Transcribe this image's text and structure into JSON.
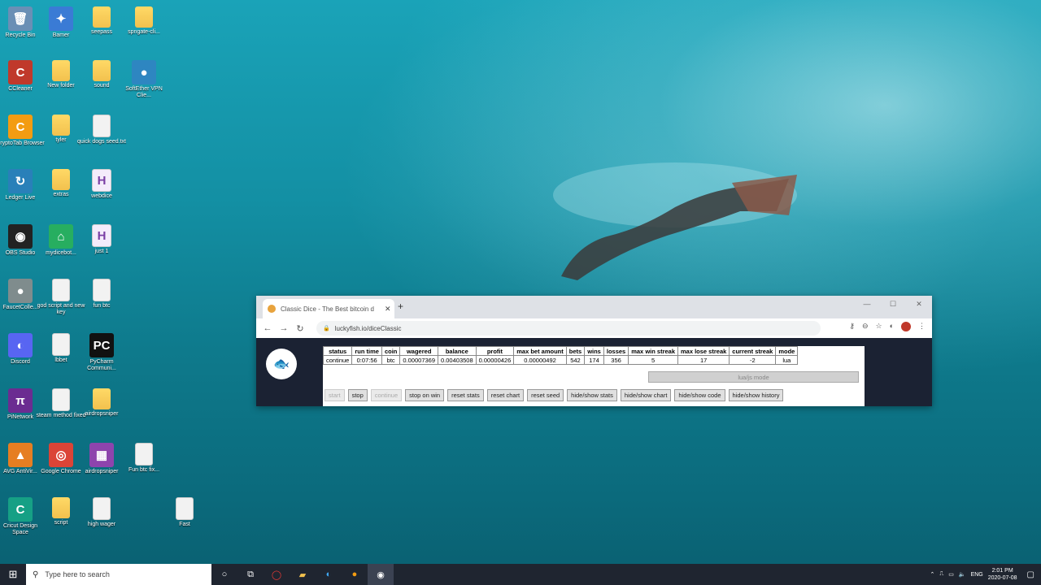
{
  "desktop": {
    "icons": [
      {
        "label": "Recycle Bin",
        "glyph": "🗑",
        "kind": "app",
        "color": "#6a8fb5"
      },
      {
        "label": "Bamer",
        "glyph": "✦",
        "kind": "app",
        "color": "#3a7bd5"
      },
      {
        "label": "seepass",
        "glyph": "",
        "kind": "folder"
      },
      {
        "label": "spngate-cli...",
        "glyph": "",
        "kind": "folder"
      },
      {
        "label": "CCleaner",
        "glyph": "C",
        "kind": "app",
        "color": "#c0392b"
      },
      {
        "label": "New folder",
        "glyph": "",
        "kind": "folder"
      },
      {
        "label": "sound",
        "glyph": "",
        "kind": "folder"
      },
      {
        "label": "SoftEther VPN Clie...",
        "glyph": "●",
        "kind": "app",
        "color": "#2e86c1"
      },
      {
        "label": "CryptoTab Browser",
        "glyph": "C",
        "kind": "app",
        "color": "#f39c12"
      },
      {
        "label": "tyler",
        "glyph": "",
        "kind": "folder"
      },
      {
        "label": "quick dogs seed.txt",
        "glyph": "",
        "kind": "file"
      },
      {
        "label": "Ledger Live",
        "glyph": "↻",
        "kind": "app",
        "color": "#2980b9"
      },
      {
        "label": "extras",
        "glyph": "",
        "kind": "folder"
      },
      {
        "label": "webdice",
        "glyph": "H",
        "kind": "hfile"
      },
      {
        "label": "OBS Studio",
        "glyph": "◉",
        "kind": "app",
        "color": "#222"
      },
      {
        "label": "mydicebot...",
        "glyph": "⌂",
        "kind": "app",
        "color": "#27ae60"
      },
      {
        "label": "just 1",
        "glyph": "H",
        "kind": "hfile"
      },
      {
        "label": "FaucetColle...",
        "glyph": "●",
        "kind": "app",
        "color": "#7f8c8d"
      },
      {
        "label": "god script and new key",
        "glyph": "",
        "kind": "file"
      },
      {
        "label": "fun btc",
        "glyph": "",
        "kind": "file"
      },
      {
        "label": "Discord",
        "glyph": "◐",
        "kind": "app",
        "color": "#5865f2"
      },
      {
        "label": "lbbet",
        "glyph": "",
        "kind": "file"
      },
      {
        "label": "PyCharm Communi...",
        "glyph": "PC",
        "kind": "app",
        "color": "#111"
      },
      {
        "label": "PiNetwork",
        "glyph": "π",
        "kind": "app",
        "color": "#6b2c91"
      },
      {
        "label": "steam method fixed",
        "glyph": "",
        "kind": "file"
      },
      {
        "label": "airdropsniper",
        "glyph": "",
        "kind": "folder"
      },
      {
        "label": "AVG AntiVir...",
        "glyph": "▲",
        "kind": "app",
        "color": "#e67e22"
      },
      {
        "label": "Google Chrome",
        "glyph": "◎",
        "kind": "app",
        "color": "#db4437"
      },
      {
        "label": "airdropsniper",
        "glyph": "▦",
        "kind": "app",
        "color": "#8e44ad"
      },
      {
        "label": "Fun btc fix...",
        "glyph": "",
        "kind": "file"
      },
      {
        "label": "Cricut Design Space",
        "glyph": "C",
        "kind": "app",
        "color": "#16a085"
      },
      {
        "label": "script",
        "glyph": "",
        "kind": "folder"
      },
      {
        "label": "high wager",
        "glyph": "",
        "kind": "file"
      },
      {
        "label": "Fast",
        "glyph": "",
        "kind": "file"
      }
    ]
  },
  "browser": {
    "tab_title": "Classic Dice - The Best bitcoin d",
    "new_tab_symbol": "+",
    "url": "luckyfish.io/diceClassic",
    "minimize": "—",
    "maximize": "☐",
    "close": "✕",
    "back": "←",
    "forward": "→",
    "reload": "↻"
  },
  "dice": {
    "logo_glyph": "🐟",
    "headers": [
      "status",
      "run time",
      "coin",
      "wagered",
      "balance",
      "profit",
      "max bet amount",
      "bets",
      "wins",
      "losses",
      "max win streak",
      "max lose streak",
      "current streak",
      "mode"
    ],
    "values": [
      "continue",
      "0:07:56",
      "btc",
      "0.00007369",
      "0.00403508",
      "0.00000426",
      "0.00000492",
      "542",
      "174",
      "356",
      "5",
      "17",
      "-2",
      "lua"
    ],
    "lua_mode_label": "lua/js mode",
    "buttons": [
      {
        "label": "start",
        "disabled": true
      },
      {
        "label": "stop",
        "disabled": false
      },
      {
        "label": "continue",
        "disabled": true
      },
      {
        "label": "stop on win",
        "disabled": false
      },
      {
        "label": "reset stats",
        "disabled": false
      },
      {
        "label": "reset chart",
        "disabled": false
      },
      {
        "label": "reset seed",
        "disabled": false
      },
      {
        "label": "hide/show stats",
        "disabled": false
      },
      {
        "label": "hide/show chart",
        "disabled": false
      },
      {
        "label": "hide/show code",
        "disabled": false
      },
      {
        "label": "hide/show history",
        "disabled": false
      }
    ]
  },
  "taskbar": {
    "search_placeholder": "Type here to search",
    "lang": "ENG",
    "time": "2:01 PM",
    "date": "2020-07-08"
  }
}
